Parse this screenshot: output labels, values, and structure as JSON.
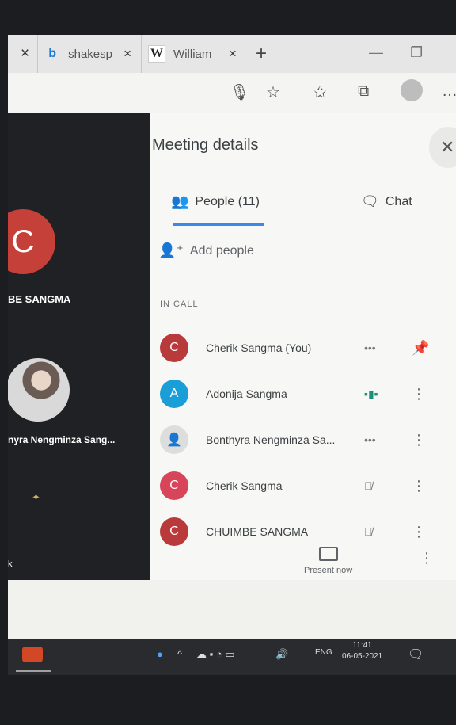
{
  "browser": {
    "tabs": [
      {
        "favicon": "bing-b-icon",
        "favicon_text": "b",
        "title": "shakesp",
        "color": "#1e7ad6"
      },
      {
        "favicon": "wikipedia-w-icon",
        "favicon_text": "W",
        "title": "William",
        "color": "#222222"
      }
    ],
    "new_tab_glyph": "+",
    "close_glyph": "×"
  },
  "meeting_tiles": [
    {
      "initial": "C",
      "name": "BE SANGMA",
      "avatar_color": "#c6403a"
    },
    {
      "name": "nyra Nengminza Sang..."
    },
    {
      "name": "k"
    }
  ],
  "panel": {
    "title": "Meeting details",
    "tab_people": "People (11)",
    "tab_chat": "Chat",
    "add_people": "Add people",
    "section_in_call": "IN CALL",
    "participants": [
      {
        "initial": "C",
        "name": "Cherik Sangma (You)",
        "color": "#b83a3a",
        "status": "•••",
        "action": "pin-icon"
      },
      {
        "initial": "A",
        "name": "Adonija Sangma",
        "color": "#1a9ed8",
        "status": "speaking",
        "action": "more-vert-icon"
      },
      {
        "initial": "",
        "name": "Bonthyra Nengminza Sa...",
        "color": "#dddddd",
        "status": "•••",
        "action": "more-vert-icon"
      },
      {
        "initial": "C",
        "name": "Cherik Sangma",
        "color": "#d8445a",
        "status": "muted",
        "action": "more-vert-icon"
      },
      {
        "initial": "C",
        "name": "CHUIMBE SANGMA",
        "color": "#b83a3a",
        "status": "muted",
        "action": "more-vert-icon"
      }
    ],
    "present_now": "Present now"
  },
  "taskbar": {
    "lang": "ENG",
    "time": "11:41",
    "date": "06-05-2021"
  }
}
